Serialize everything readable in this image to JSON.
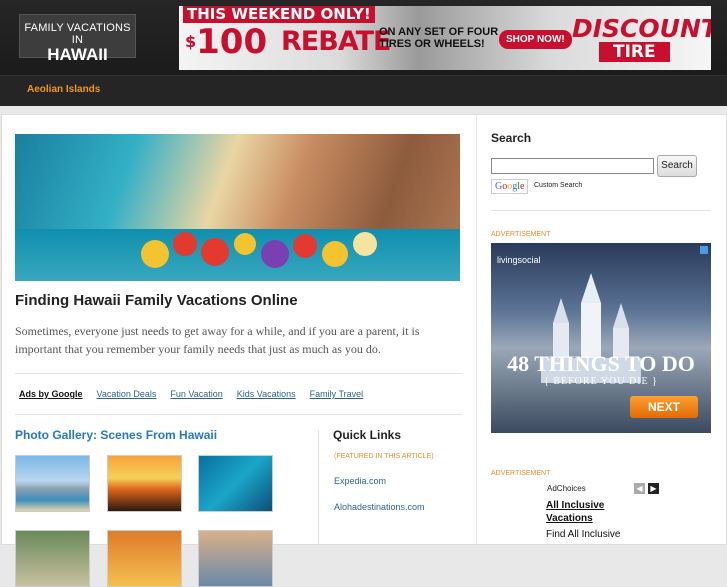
{
  "header": {
    "logo": {
      "line1": "FAMILY VACATIONS IN",
      "line2": "HAWAII"
    },
    "banner": {
      "headline": "THIS WEEKEND ONLY!",
      "dollar": "$",
      "amount": "100",
      "rebate": "REBATE",
      "offer": "ON ANY SET OF FOUR TIRES OR WHEELS!",
      "cta": "SHOP NOW!",
      "brand": "DISCOUNT",
      "brand_sub": "TIRE"
    }
  },
  "nav": {
    "items": [
      {
        "label": "Aeolian Islands"
      }
    ]
  },
  "article": {
    "title": "Finding Hawaii Family Vacations Online",
    "intro": "Sometimes, everyone just needs to get away for a while, and if you are a parent, it is important that you remember your family needs that just as much as you do."
  },
  "ads_by_google": {
    "label": "Ads by Google",
    "links": [
      "Vacation Deals",
      "Fun Vacation",
      "Kids Vacations",
      "Family Travel"
    ]
  },
  "gallery": {
    "title": "Photo Gallery: Scenes From Hawaii"
  },
  "quick_links": {
    "title": "Quick Links",
    "featured": "(FEATURED IN THIS ARTICLE)",
    "links": [
      "Expedia.com",
      "Alohadestinations.com"
    ]
  },
  "sidebar": {
    "search_title": "Search",
    "search_value": "",
    "search_button": "Search",
    "google_logo": "Google",
    "custom_search": "Custom Search",
    "advertisement_label": "ADVERTISEMENT",
    "ad_brand": "livingsocial",
    "ad_headline": "48 THINGS TO DO",
    "ad_subline": "{ BEFORE YOU DIE }",
    "ad_cta": "NEXT",
    "adchoices": "AdChoices",
    "ad2_link": "All Inclusive Vacations",
    "ad2_text": "Find All Inclusive"
  },
  "colors": {
    "accent": "#f09a1c",
    "link": "#2777c4",
    "nav_bg": "#252525"
  }
}
